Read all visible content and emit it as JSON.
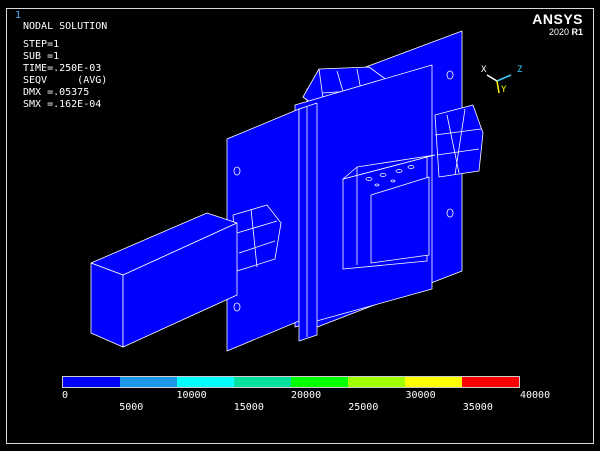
{
  "window": {
    "number": "1"
  },
  "results": {
    "title": "NODAL SOLUTION",
    "step": "STEP=1",
    "sub": "SUB =1",
    "time": "TIME=.250E-03",
    "seqv": "SEQV     (AVG)",
    "dmx": "DMX =.05375",
    "smx": "SMX =.162E-04"
  },
  "brand": {
    "logo": "ANSYS",
    "version": "2020",
    "release": "R1"
  },
  "triad": {
    "x": "X",
    "y": "Y",
    "z": "Z"
  },
  "legend": {
    "colors": [
      "#0000ff",
      "#1a98e5",
      "#00ffff",
      "#00e0a0",
      "#00ff00",
      "#a0ff00",
      "#ffff00",
      "#ff0000"
    ],
    "labels_top": [
      "0",
      "10000",
      "20000",
      "30000",
      "40000"
    ],
    "labels_bottom": [
      "5000",
      "15000",
      "25000",
      "35000"
    ]
  }
}
